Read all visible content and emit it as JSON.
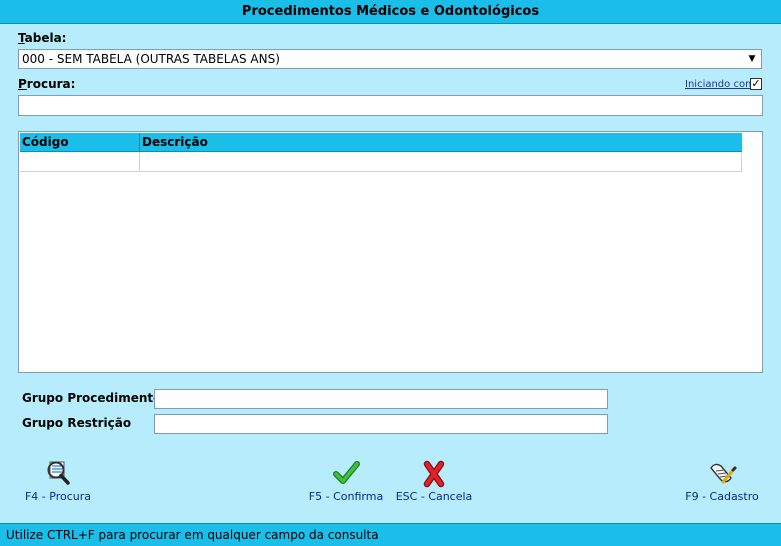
{
  "window": {
    "title": "Procedimentos Médicos e Odontológicos"
  },
  "tabela": {
    "label_accesskey": "T",
    "label_rest": "abela:",
    "selected": "000 - SEM TABELA (OUTRAS TABELAS ANS)"
  },
  "procura": {
    "label_accesskey": "P",
    "label_rest": "rocura:",
    "value": "",
    "iniciando_label": "Iniciando com",
    "iniciando_checked": true
  },
  "grid": {
    "columns": [
      "Código",
      "Descrição"
    ],
    "rows": [
      [
        "",
        ""
      ]
    ]
  },
  "grupos": {
    "procedimento_label": "Grupo Procedimento",
    "procedimento_value": "",
    "restricao_label": "Grupo Restrição",
    "restricao_value": ""
  },
  "buttons": {
    "procura": "F4 - Procura",
    "confirma": "F5 - Confirma",
    "cancela": "ESC - Cancela",
    "cadastro": "F9 - Cadastro"
  },
  "status": {
    "text": "Utilize CTRL+F  para procurar em qualquer campo da consulta"
  },
  "colors": {
    "accent": "#1bbde9",
    "background": "#b6ecfb",
    "confirm": "#2a9d2a",
    "cancel": "#d0141e"
  }
}
